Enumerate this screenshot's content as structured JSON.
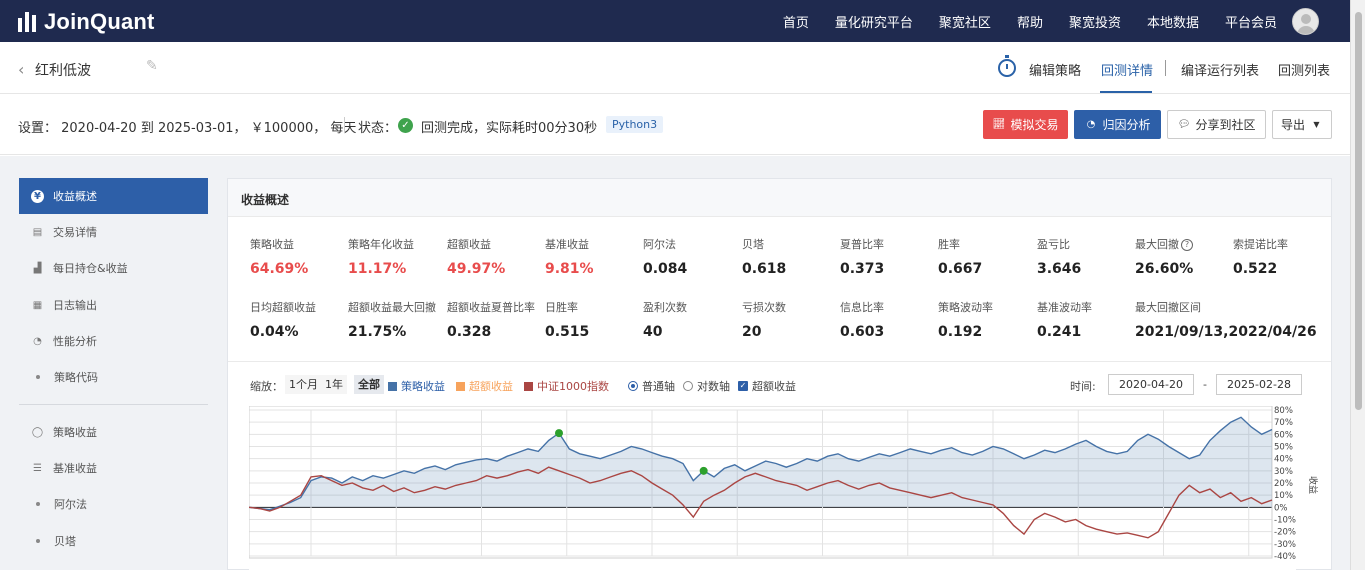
{
  "brand": {
    "name": "JoinQuant"
  },
  "nav": {
    "items": [
      "首页",
      "量化研究平台",
      "聚宽社区",
      "帮助",
      "聚宽投资",
      "本地数据",
      "平台会员"
    ]
  },
  "strategy": {
    "name": "红利低波",
    "tabs": [
      "编辑策略",
      "回测详情",
      "编译运行列表",
      "回测列表"
    ],
    "active_tab": "回测详情"
  },
  "settings": {
    "text": "设置： 2020-04-20 到 2025-03-01， ￥100000， 每天",
    "status_label": "状态：",
    "status_text": "回测完成，实际耗时00分30秒",
    "python": "Python3",
    "buttons": {
      "simulate": "模拟交易",
      "attribution": "归因分析",
      "share": "分享到社区",
      "export": "导出"
    }
  },
  "sidebar": {
    "items": [
      {
        "label": "收益概述",
        "icon": "yen-circle-icon"
      },
      {
        "label": "交易详情",
        "icon": "document-icon"
      },
      {
        "label": "每日持仓&收益",
        "icon": "bar-chart-icon"
      },
      {
        "label": "日志输出",
        "icon": "calendar-icon"
      },
      {
        "label": "性能分析",
        "icon": "pie-chart-icon"
      },
      {
        "label": "策略代码",
        "icon": "dot"
      },
      {
        "label": "策略收益",
        "icon": "lightbulb-icon"
      },
      {
        "label": "基准收益",
        "icon": "database-icon"
      },
      {
        "label": "阿尔法",
        "icon": "dot"
      },
      {
        "label": "贝塔",
        "icon": "dot"
      }
    ]
  },
  "panel": {
    "title": "收益概述",
    "metrics_row1": [
      {
        "label": "策略收益",
        "value": "64.69%",
        "color": "red"
      },
      {
        "label": "策略年化收益",
        "value": "11.17%",
        "color": "red"
      },
      {
        "label": "超额收益",
        "value": "49.97%",
        "color": "red"
      },
      {
        "label": "基准收益",
        "value": "9.81%",
        "color": "red"
      },
      {
        "label": "阿尔法",
        "value": "0.084",
        "color": "black"
      },
      {
        "label": "贝塔",
        "value": "0.618",
        "color": "black"
      },
      {
        "label": "夏普比率",
        "value": "0.373",
        "color": "black"
      },
      {
        "label": "胜率",
        "value": "0.667",
        "color": "black"
      },
      {
        "label": "盈亏比",
        "value": "3.646",
        "color": "black"
      },
      {
        "label": "最大回撤",
        "value": "26.60%",
        "color": "black"
      },
      {
        "label": "索提诺比率",
        "value": "0.522",
        "color": "black"
      }
    ],
    "metrics_row2": [
      {
        "label": "日均超额收益",
        "value": "0.04%"
      },
      {
        "label": "超额收益最大回撤",
        "value": "21.75%"
      },
      {
        "label": "超额收益夏普比率",
        "value": "0.328"
      },
      {
        "label": "日胜率",
        "value": "0.515"
      },
      {
        "label": "盈利次数",
        "value": "40"
      },
      {
        "label": "亏损次数",
        "value": "20"
      },
      {
        "label": "信息比率",
        "value": "0.603"
      },
      {
        "label": "策略波动率",
        "value": "0.192"
      },
      {
        "label": "基准波动率",
        "value": "0.241"
      },
      {
        "label": "最大回撤区间",
        "value": "2021/09/13,2022/04/26"
      }
    ],
    "controls": {
      "zoom_label": "缩放：",
      "zoom_options": [
        "1个月",
        "1年",
        "全部"
      ],
      "zoom_active": "全部",
      "legend": [
        {
          "name": "策略收益",
          "color": "#4572a7"
        },
        {
          "name": "超额收益",
          "color": "#f7a35c"
        },
        {
          "name": "中证1000指数",
          "color": "#aa4643"
        }
      ],
      "axis_normal": "普通轴",
      "axis_log": "对数轴",
      "excess_checkbox": "超额收益",
      "time_label": "时间:",
      "date_from": "2020-04-20",
      "date_sep": "-",
      "date_to": "2025-02-28"
    }
  },
  "chart_data": {
    "type": "area",
    "ylabel": "收益",
    "ylim": [
      -40,
      80
    ],
    "yticks": [
      "80%",
      "70%",
      "60%",
      "50%",
      "40%",
      "30%",
      "20%",
      "10%",
      "0%",
      "-10%",
      "-20%",
      "-30%",
      "-40%"
    ],
    "series": [
      {
        "name": "策略收益",
        "color": "#4572a7",
        "values": [
          0,
          -1,
          -2,
          1,
          4,
          8,
          22,
          25,
          24,
          20,
          25,
          22,
          26,
          24,
          27,
          30,
          28,
          32,
          34,
          31,
          35,
          37,
          39,
          40,
          38,
          42,
          45,
          48,
          46,
          55,
          61,
          48,
          44,
          42,
          40,
          43,
          46,
          50,
          48,
          45,
          42,
          40,
          36,
          22,
          30,
          25,
          32,
          35,
          30,
          34,
          38,
          36,
          33,
          36,
          40,
          38,
          42,
          44,
          40,
          38,
          41,
          44,
          42,
          45,
          48,
          46,
          44,
          47,
          49,
          45,
          43,
          46,
          50,
          48,
          44,
          40,
          43,
          47,
          45,
          48,
          52,
          55,
          50,
          46,
          44,
          46,
          55,
          60,
          56,
          50,
          45,
          40,
          43,
          55,
          63,
          70,
          74,
          66,
          60,
          64
        ]
      },
      {
        "name": "中证1000指数",
        "color": "#aa4643",
        "values": [
          0,
          -1,
          -3,
          0,
          5,
          10,
          25,
          26,
          22,
          18,
          20,
          16,
          14,
          18,
          13,
          16,
          12,
          14,
          17,
          15,
          18,
          20,
          22,
          26,
          24,
          26,
          29,
          31,
          28,
          33,
          30,
          27,
          24,
          20,
          22,
          25,
          28,
          30,
          26,
          20,
          15,
          10,
          2,
          -8,
          5,
          10,
          14,
          20,
          25,
          28,
          25,
          22,
          20,
          18,
          14,
          17,
          20,
          22,
          18,
          15,
          18,
          20,
          16,
          14,
          12,
          10,
          8,
          10,
          12,
          8,
          6,
          4,
          2,
          -5,
          -15,
          -22,
          -10,
          -5,
          -8,
          -12,
          -10,
          -15,
          -18,
          -20,
          -22,
          -21,
          -23,
          -25,
          -20,
          -5,
          10,
          18,
          12,
          15,
          8,
          12,
          5,
          8,
          3,
          6
        ]
      }
    ],
    "markers": [
      {
        "series": "策略收益",
        "index": 30,
        "color": "#2ca02c"
      },
      {
        "series": "策略收益",
        "index": 44,
        "color": "#2ca02c"
      }
    ]
  }
}
